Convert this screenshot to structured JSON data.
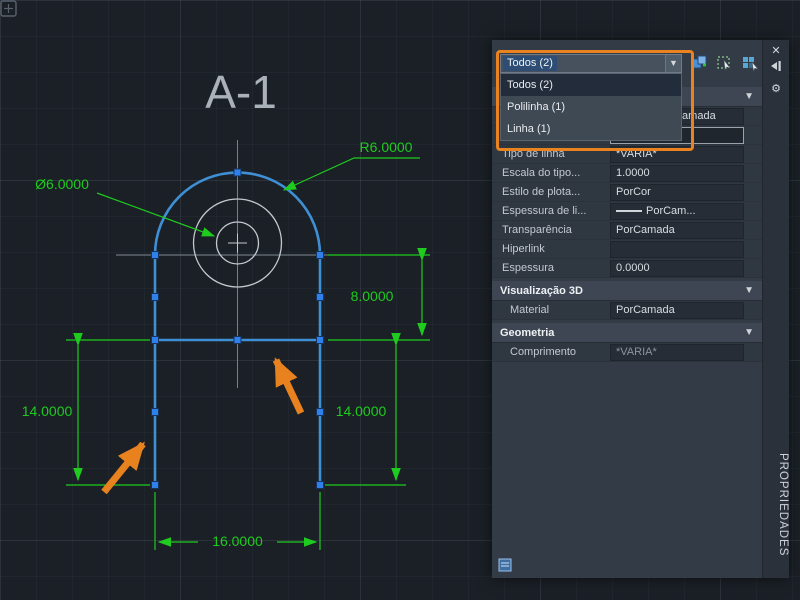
{
  "colors": {
    "dim_green": "#1ecb1e",
    "shape_blue": "#3f8fd4",
    "grip_blue": "#2f80ea",
    "annotation_orange": "#e8821e",
    "centerline_teal": "#1aa8a8"
  },
  "canvas": {
    "title": "A-1",
    "dimensions": {
      "radius": "R6.0000",
      "diameter": "Ø6.0000",
      "height_right": "8.0000",
      "height_left": "14.0000",
      "height_right_lower": "14.0000",
      "width_bottom": "16.0000"
    }
  },
  "panel": {
    "vertical_title": "PROPRIEDADES",
    "selector": {
      "value": "Todos (2)",
      "options": [
        {
          "label": "Todos (2)"
        },
        {
          "label": "Polilinha (1)"
        },
        {
          "label": "Linha (1)"
        }
      ]
    },
    "rows": [
      {
        "label": "",
        "value": "PorCamada"
      },
      {
        "label": "",
        "value": ""
      },
      {
        "label": "Tipo de linha",
        "value": "*VARIA*"
      },
      {
        "label": "Escala do tipo...",
        "value": "1.0000"
      },
      {
        "label": "Estilo de plota...",
        "value": "PorCor"
      },
      {
        "label": "Espessura de li...",
        "value": "PorCam..."
      },
      {
        "label": "Transparência",
        "value": "PorCamada"
      },
      {
        "label": "Hiperlink",
        "value": ""
      },
      {
        "label": "Espessura",
        "value": "0.0000"
      }
    ],
    "sections": [
      {
        "title": "Visualização 3D",
        "rows": [
          {
            "label": "Material",
            "value": "PorCamada"
          }
        ]
      },
      {
        "title": "Geometria",
        "rows": [
          {
            "label": "Comprimento",
            "value": "*VARIA*"
          }
        ]
      }
    ]
  }
}
